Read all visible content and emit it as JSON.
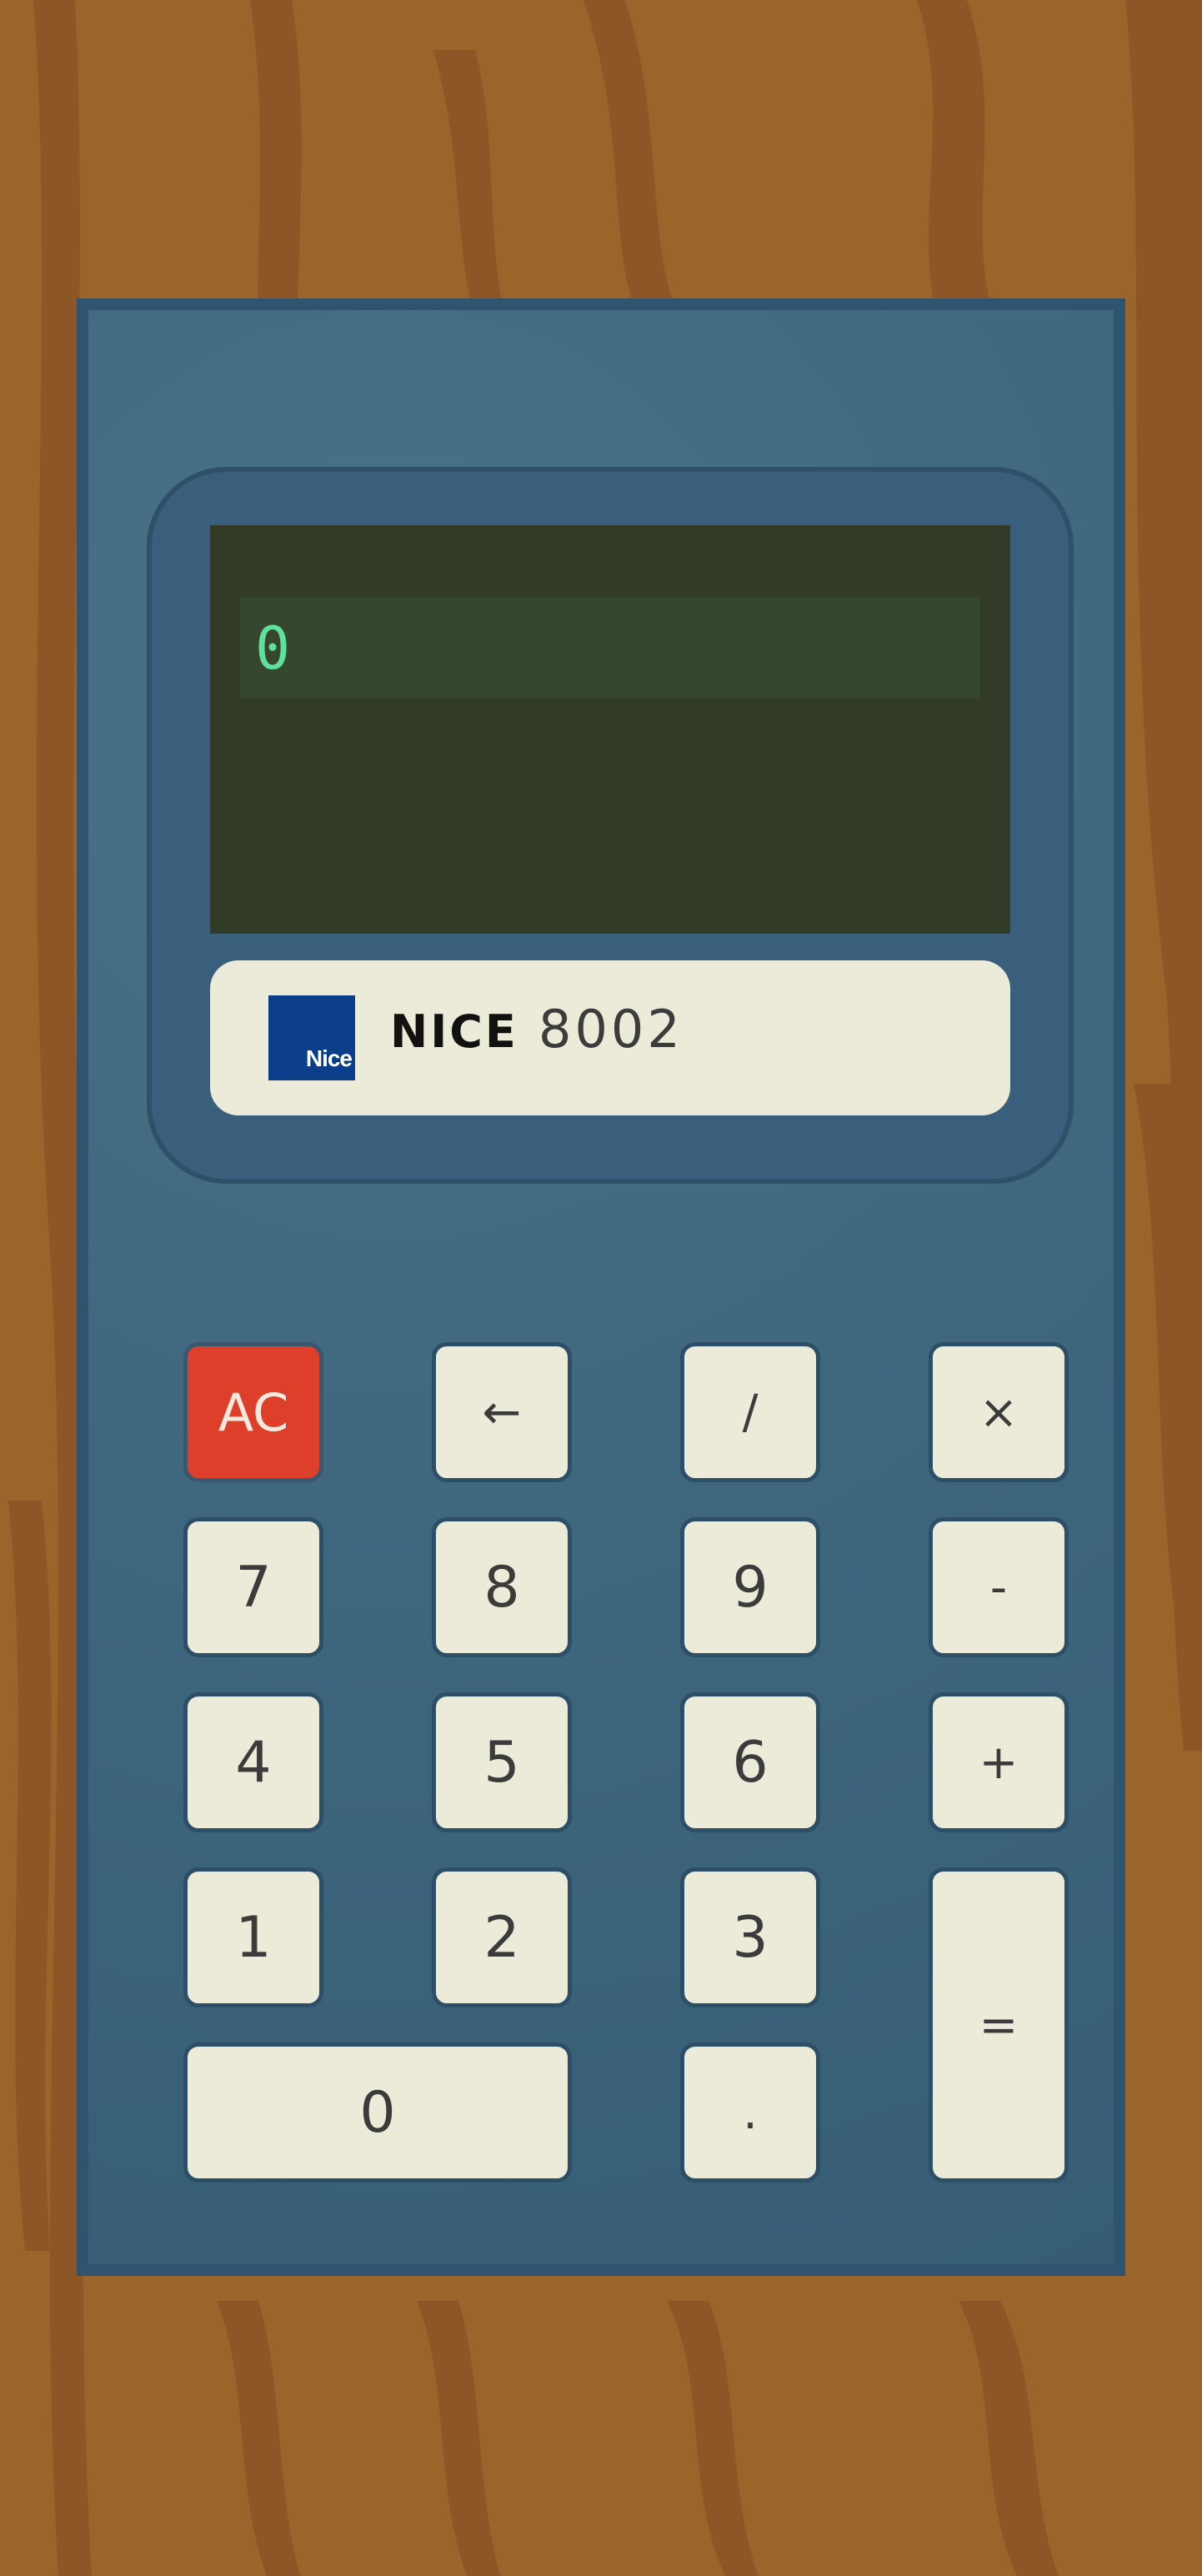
{
  "display": {
    "value": "0"
  },
  "brand": {
    "logo_text": "Nice",
    "name": "NICE",
    "model": "8002"
  },
  "keys": {
    "ac": "AC",
    "backspace": "←",
    "divide": "/",
    "multiply": "×",
    "seven": "7",
    "eight": "8",
    "nine": "9",
    "minus": "-",
    "four": "4",
    "five": "5",
    "six": "6",
    "plus": "+",
    "one": "1",
    "two": "2",
    "three": "3",
    "equals": "=",
    "zero": "0",
    "decimal": "."
  },
  "colors": {
    "wood": "#9a652b",
    "wood_grain": "#8c5626",
    "body": "#3d657c",
    "lcd": "#323b27",
    "lcd_digits": "#5fe09b",
    "key": "#ecebd9",
    "ac_key": "#de3f2b",
    "logo": "#0b3e8a"
  }
}
